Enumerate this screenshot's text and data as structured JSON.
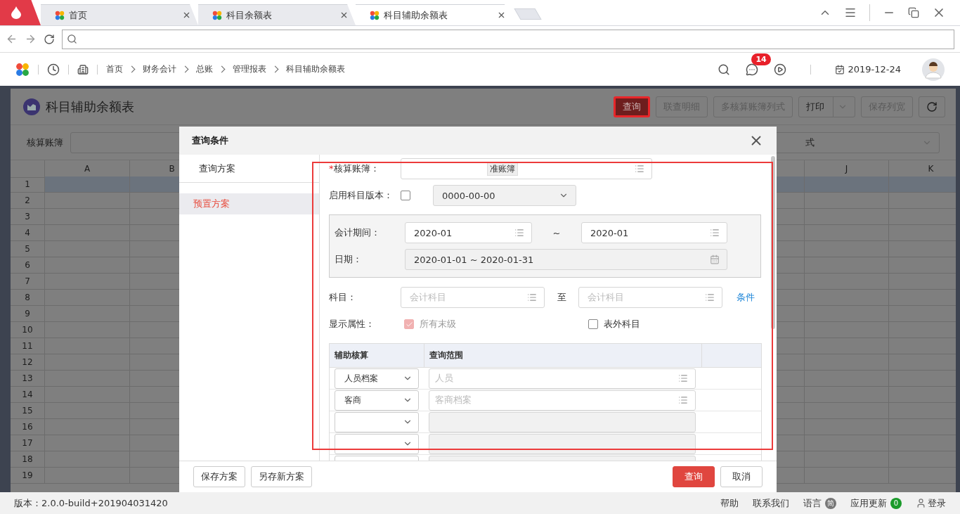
{
  "browser": {
    "tabs": [
      {
        "label": "首页",
        "selected": false
      },
      {
        "label": "科目余额表",
        "selected": false
      },
      {
        "label": "科目辅助余额表",
        "selected": true
      }
    ]
  },
  "app_bar": {
    "breadcrumb": [
      "首页",
      "财务会计",
      "总账",
      "管理报表",
      "科目辅助余额表"
    ],
    "message_count": "14",
    "date": "2019-12-24"
  },
  "page": {
    "title": "科目辅助余额表",
    "toolbar": [
      {
        "label": "查询",
        "kind": "highlighted"
      },
      {
        "label": "联查明细",
        "kind": "button",
        "disabled": true
      },
      {
        "label": "多核算账簿列式",
        "kind": "button",
        "disabled": true
      },
      {
        "label": "打印",
        "kind": "split",
        "disabled": false
      },
      {
        "label": "保存列宽",
        "kind": "button",
        "disabled": true
      },
      {
        "kind": "refresh",
        "disabled": false
      }
    ],
    "filter_label": "核算账簿",
    "filter_select_value": "式"
  },
  "grid": {
    "columns": [
      "A",
      "B",
      "J",
      "K"
    ],
    "rows": [
      "1",
      "2",
      "3",
      "4",
      "5",
      "6",
      "7",
      "8",
      "9",
      "10",
      "11",
      "12",
      "13",
      "14",
      "15",
      "16",
      "17",
      "18",
      "19"
    ]
  },
  "dialog": {
    "title": "查询条件",
    "nav": {
      "heading": "查询方案",
      "items": [
        {
          "label": "预置方案",
          "selected": true
        }
      ]
    },
    "form": {
      "ledger": {
        "required_mark": "*",
        "label": "核算账簿：",
        "value": "准账簿"
      },
      "version": {
        "label": "启用科目版本：",
        "checked": false,
        "value": "0000-00-00"
      },
      "period": {
        "label": "会计期间：",
        "from": "2020-01",
        "separator": "~",
        "to": "2020-01"
      },
      "date": {
        "label": "日期：",
        "value": "2020-01-01 ~ 2020-01-31"
      },
      "subject": {
        "label": "科目：",
        "from_placeholder": "会计科目",
        "separator": "至",
        "to_placeholder": "会计科目",
        "link": "条件"
      },
      "display": {
        "label": "显示属性：",
        "options": [
          {
            "label": "所有末级",
            "checked": true,
            "disabled": true
          },
          {
            "label": "表外科目",
            "checked": false,
            "disabled": false
          }
        ]
      },
      "aux_table": {
        "columns": [
          "辅助核算",
          "查询范围"
        ],
        "rows": [
          {
            "type": "人员档案",
            "scope_placeholder": "人员",
            "enabled": true
          },
          {
            "type": "客商",
            "scope_placeholder": "客商档案",
            "enabled": true
          },
          {
            "enabled": false
          },
          {
            "enabled": false
          },
          {
            "enabled": false
          }
        ]
      }
    },
    "buttons_left": [
      "保存方案",
      "另存新方案"
    ],
    "buttons_right": [
      {
        "label": "查询",
        "kind": "primary"
      },
      {
        "label": "取消",
        "kind": "default"
      }
    ]
  },
  "status_bar": {
    "version": "版本：2.0.0-build+201904031420",
    "links": [
      "帮助",
      "联系我们"
    ],
    "language": {
      "label": "语言",
      "badge": "简"
    },
    "update": {
      "label": "应用更新",
      "badge": "0"
    },
    "login": "登录"
  }
}
